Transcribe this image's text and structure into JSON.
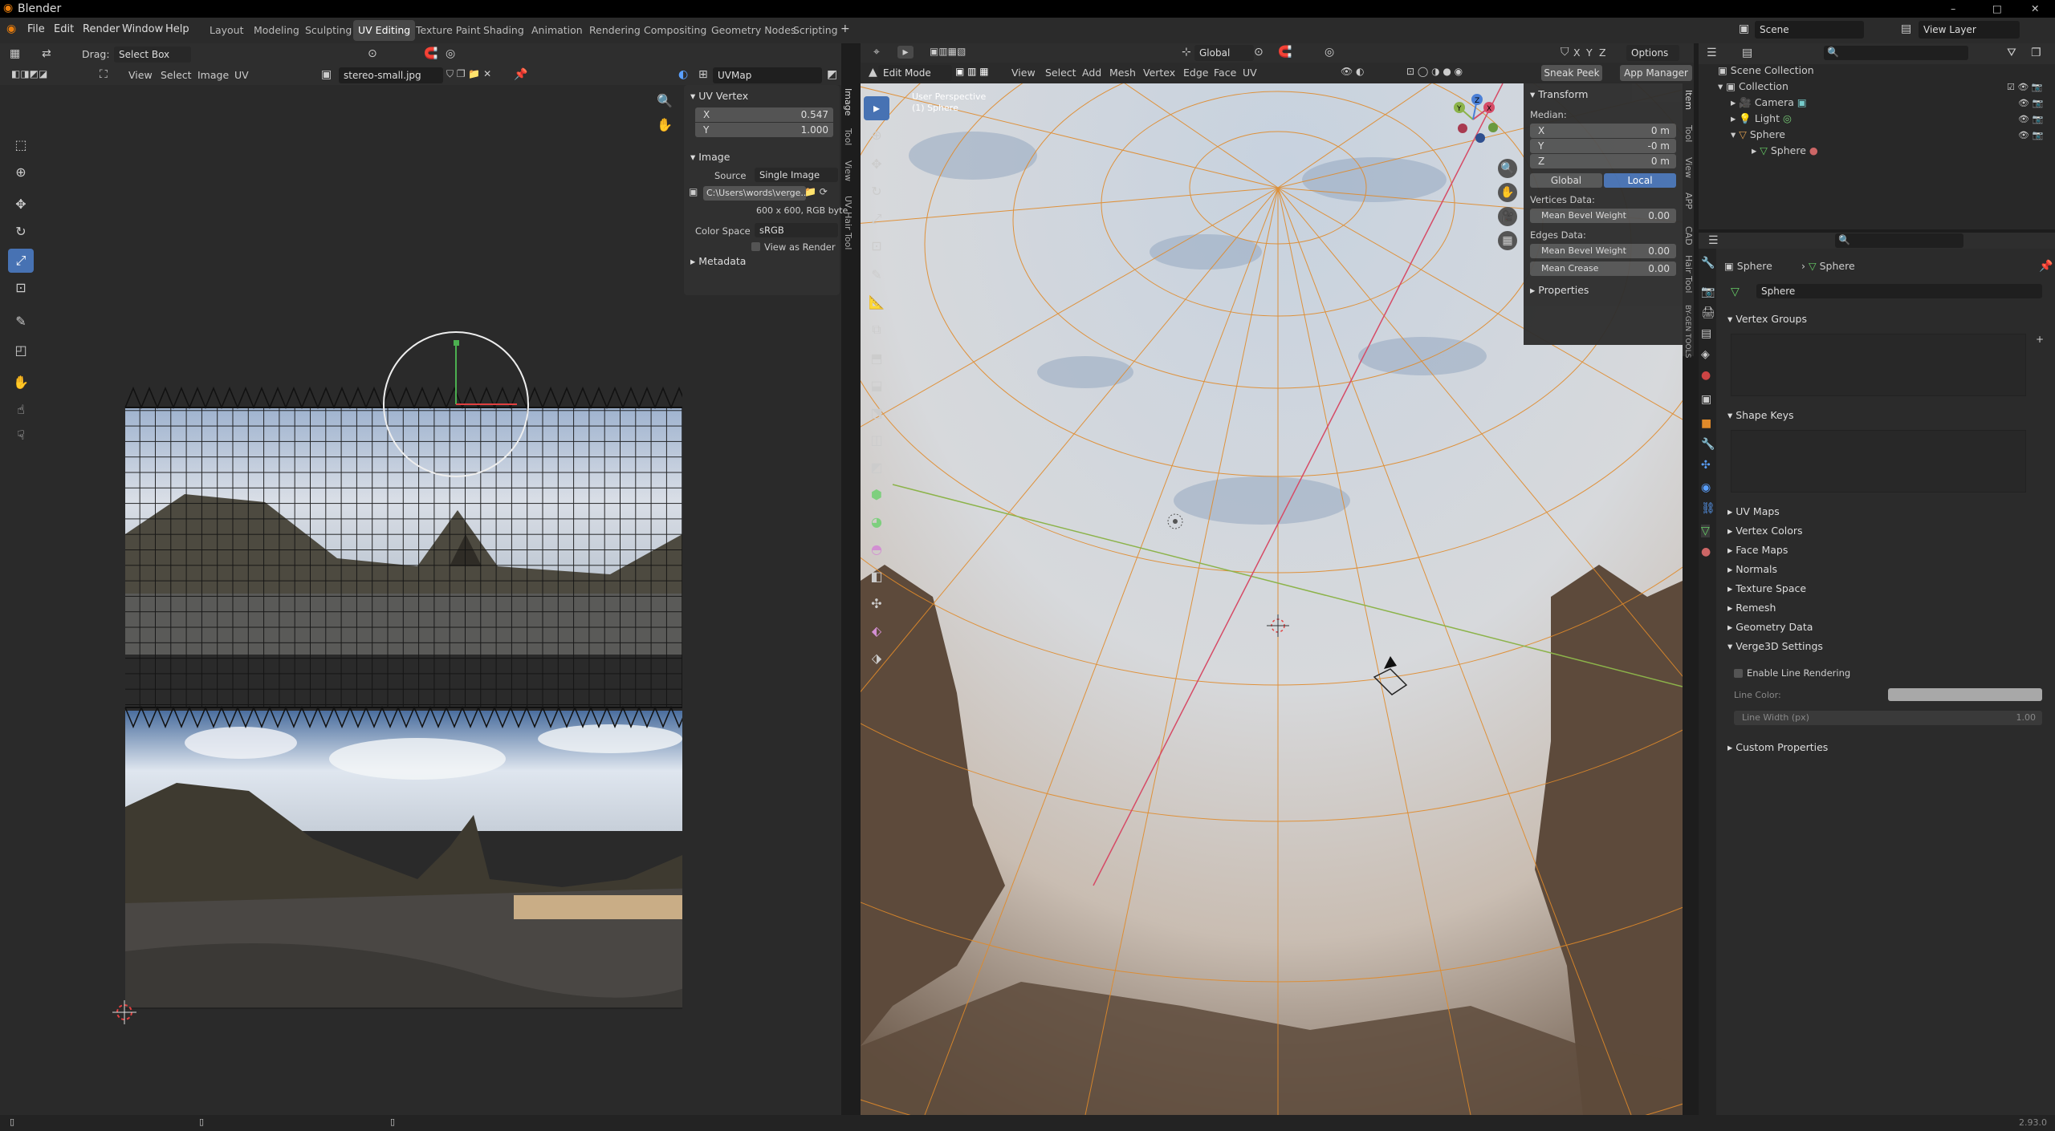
{
  "window": {
    "title": "Blender",
    "controls": [
      "–",
      "□",
      "✕"
    ]
  },
  "menu": {
    "items": [
      "File",
      "Edit",
      "Render",
      "Window",
      "Help"
    ]
  },
  "workspaces": {
    "tabs": [
      "Layout",
      "Modeling",
      "Sculpting",
      "UV Editing",
      "Texture Paint",
      "Shading",
      "Animation",
      "Rendering",
      "Compositing",
      "Geometry Nodes",
      "Scripting"
    ],
    "active": "UV Editing"
  },
  "scene": {
    "name": "Scene",
    "view_layer": "View Layer"
  },
  "uv_editor": {
    "drag_label": "Drag:",
    "drag_value": "Select Box",
    "menus": [
      "View",
      "Select",
      "Image",
      "UV"
    ],
    "image_name": "stereo-small.jpg",
    "uvmap": "UVMap",
    "vtabs": [
      "Image",
      "Tool",
      "View",
      "UV",
      "Hair Tool"
    ],
    "uv_vertex": {
      "title": "UV Vertex",
      "x_label": "X",
      "x": "0.547",
      "y_label": "Y",
      "y": "1.000"
    },
    "image_panel": {
      "title": "Image",
      "source_label": "Source",
      "source": "Single Image",
      "path": "C:\\Users\\words\\verge...",
      "info": "600 x 600,  RGB byte",
      "colorspace_label": "Color Space",
      "colorspace": "sRGB",
      "view_as_render": "View as Render"
    },
    "metadata": "Metadata"
  },
  "viewport": {
    "mode": "Edit Mode",
    "menus": [
      "View",
      "Select",
      "Add",
      "Mesh",
      "Vertex",
      "Edge",
      "Face",
      "UV"
    ],
    "orientation": "Global",
    "options": "Options",
    "xyz": [
      "X",
      "Y",
      "Z"
    ],
    "sneak_peek": "Sneak Peek",
    "app_manager": "App Manager",
    "overlay_title": "User Perspective",
    "overlay_sub": "(1) Sphere",
    "vtabs": [
      "Item",
      "Tool",
      "View",
      "APP",
      "CAD",
      "Hair Tool",
      "BY-GEN TOOLS"
    ],
    "transform": {
      "title": "Transform",
      "median": "Median:",
      "x_label": "X",
      "x": "0 m",
      "y_label": "Y",
      "y": "-0 m",
      "z_label": "Z",
      "z": "0 m",
      "global": "Global",
      "local": "Local",
      "vertices_data": "Vertices Data:",
      "mean_bevel_weight": "Mean Bevel Weight",
      "vbw": "0.00",
      "edges_data": "Edges Data:",
      "ebw_label": "Mean Bevel Weight",
      "ebw": "0.00",
      "mean_crease": "Mean Crease",
      "crease": "0.00",
      "properties": "Properties"
    },
    "gizmo": {
      "x": "X",
      "y": "Y",
      "z": "Z"
    }
  },
  "outliner": {
    "root": "Scene Collection",
    "items": [
      {
        "label": "Collection"
      },
      {
        "label": "Camera"
      },
      {
        "label": "Light"
      },
      {
        "label": "Sphere"
      },
      {
        "label": "Sphere"
      }
    ]
  },
  "properties": {
    "object": "Sphere",
    "mesh": "Sphere",
    "mesh_name": "Sphere",
    "vertex_groups": "Vertex Groups",
    "shape_keys": "Shape Keys",
    "collapsed": [
      "UV Maps",
      "Vertex Colors",
      "Face Maps",
      "Normals",
      "Texture Space",
      "Remesh",
      "Geometry Data"
    ],
    "verge3d": "Verge3D Settings",
    "enable_line": "Enable Line Rendering",
    "line_color": "Line Color:",
    "line_width": "Line Width (px)",
    "line_width_val": "1.00",
    "custom": "Custom Properties"
  },
  "status": {
    "version": "2.93.0"
  }
}
